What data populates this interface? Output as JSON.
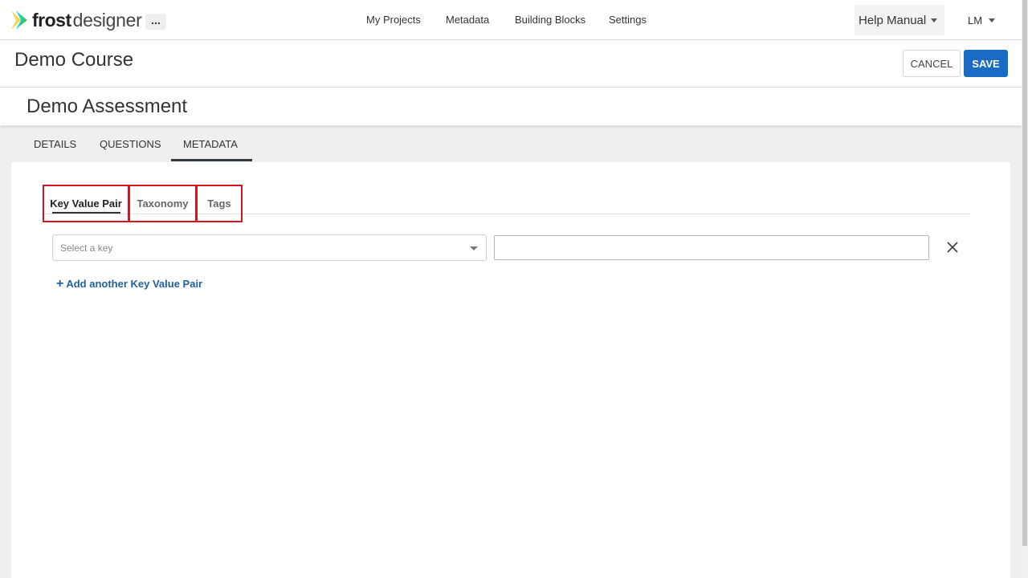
{
  "app": {
    "logo_bold": "frost",
    "logo_light": "designer",
    "more_label": "..."
  },
  "nav": {
    "items": [
      {
        "label": "My Projects"
      },
      {
        "label": "Metadata"
      },
      {
        "label": "Building Blocks"
      },
      {
        "label": "Settings"
      }
    ]
  },
  "header_right": {
    "help_label": "Help Manual",
    "user_initials": "LM"
  },
  "course": {
    "title": "Demo Course",
    "cancel_label": "CANCEL",
    "save_label": "SAVE"
  },
  "assessment": {
    "title": "Demo Assessment"
  },
  "main_tabs": [
    {
      "label": "DETAILS"
    },
    {
      "label": "QUESTIONS"
    },
    {
      "label": "METADATA",
      "active": true
    }
  ],
  "sub_tabs": [
    {
      "label": "Key Value Pair",
      "active": true
    },
    {
      "label": "Taxonomy"
    },
    {
      "label": "Tags"
    }
  ],
  "kv_form": {
    "key_placeholder": "Select a key",
    "value": "",
    "remove_icon": "close-icon",
    "add_label": "Add another Key Value Pair"
  },
  "colors": {
    "primary": "#1a6bc4",
    "link": "#1f5f9e",
    "highlight_box": "#d8131b",
    "loading_bar": "#f5e94a",
    "logo_green": "#2ecc71",
    "logo_cyan": "#1ec8d8",
    "logo_yellow": "#f2d64b"
  }
}
